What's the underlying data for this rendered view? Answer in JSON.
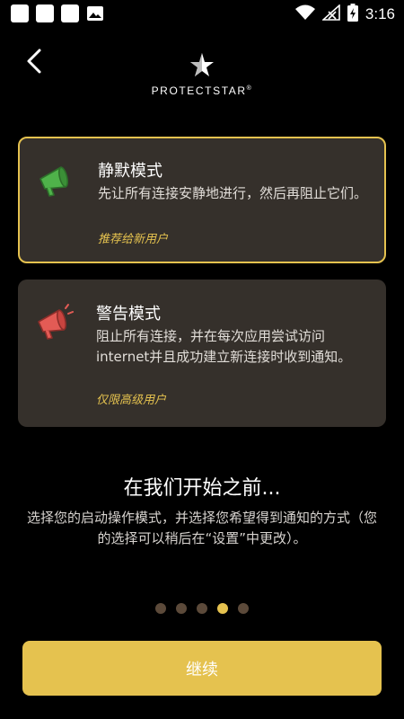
{
  "status_bar": {
    "time": "3:16",
    "icons": [
      "notification-square-icon",
      "notification-square-icon",
      "notification-square-icon",
      "image-icon",
      "wifi-icon",
      "signal-icon",
      "battery-icon"
    ]
  },
  "header": {
    "logo_text": "PROTECTSTAR",
    "logo_mark": "®"
  },
  "modes": [
    {
      "title": "静默模式",
      "description": "先让所有连接安静地进行，然后再阻止它们。",
      "note": "推荐给新用户",
      "icon": "megaphone-green-icon",
      "selected": true
    },
    {
      "title": "警告模式",
      "description": "阻止所有连接，并在每次应用尝试访问internet并且成功建立新连接时收到通知。",
      "note": "仅限高级用户",
      "icon": "megaphone-red-icon",
      "selected": false
    }
  ],
  "intro": {
    "heading": "在我们开始之前...",
    "subtitle": "选择您的启动操作模式，并选择您希望得到通知的方式（您的选择可以稍后在“设置”中更改）。"
  },
  "pager": {
    "total": 5,
    "current": 4
  },
  "continue_label": "继续",
  "colors": {
    "accent": "#e5c24f",
    "card_bg": "#35302b",
    "dot_inactive": "#5c4a3a",
    "silent_icon": "#4fb24a",
    "warning_icon": "#e35b55"
  }
}
